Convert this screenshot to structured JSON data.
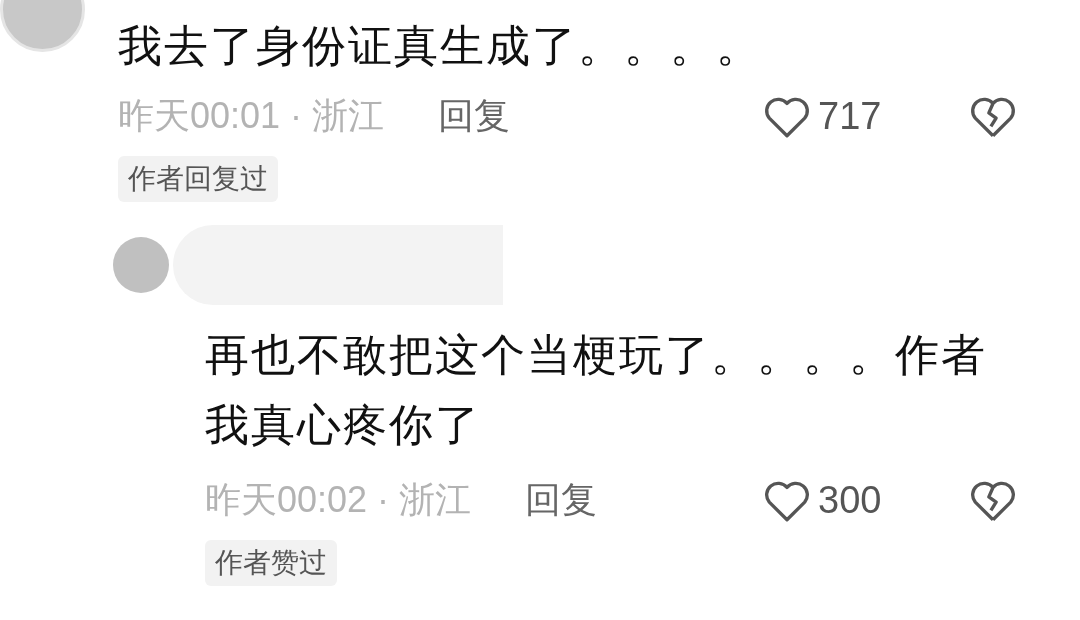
{
  "comments": [
    {
      "text": "我去了身份证真生成了。。。。",
      "time": "昨天00:01",
      "separator": "·",
      "location": "浙江",
      "reply_label": "回复",
      "likes": "717",
      "badge": "作者回复过",
      "replies": [
        {
          "text": "再也不敢把这个当梗玩了。。。。作者我真心疼你了",
          "time": "昨天00:02",
          "separator": "·",
          "location": "浙江",
          "reply_label": "回复",
          "likes": "300",
          "badge": "作者赞过"
        }
      ]
    }
  ]
}
